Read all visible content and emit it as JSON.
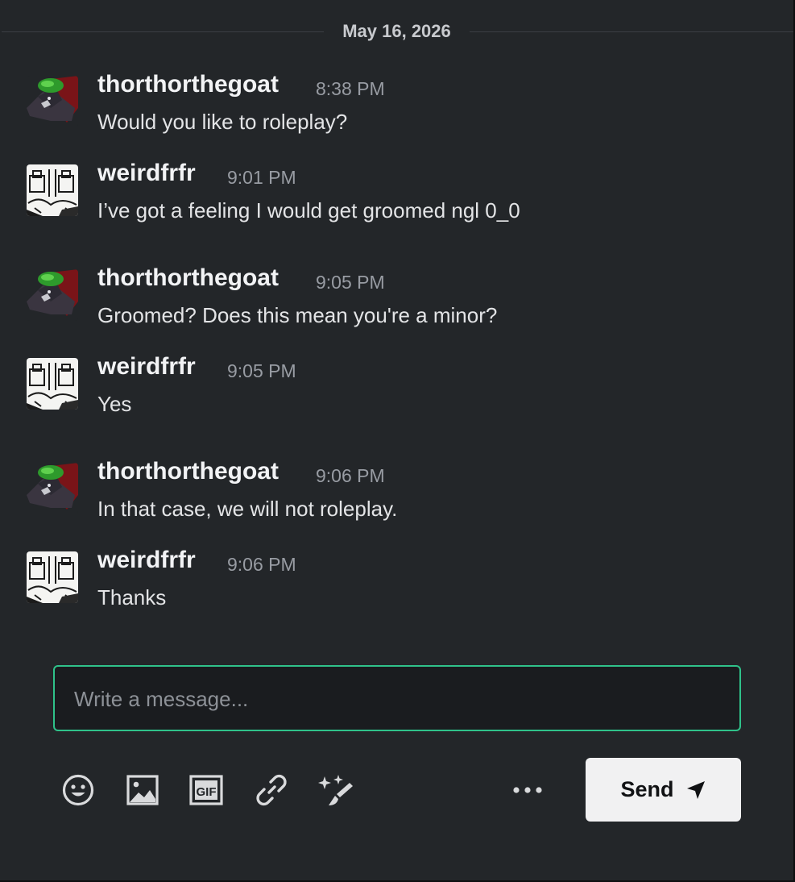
{
  "date_divider": "May 16, 2026",
  "messages": [
    {
      "username": "thorthorthegoat",
      "time": "8:38 PM",
      "text": "Would you like to roleplay?",
      "avatar_icon": "goat-character-avatar-icon"
    },
    {
      "username": "weirdfrfr",
      "time": "9:01 PM",
      "text": "I’ve got a feeling I would get groomed ngl 0_0",
      "avatar_icon": "sketch-drawing-avatar-icon"
    },
    {
      "username": "thorthorthegoat",
      "time": "9:05 PM",
      "text": "Groomed? Does this mean you're a minor?",
      "avatar_icon": "goat-character-avatar-icon"
    },
    {
      "username": "weirdfrfr",
      "time": "9:05 PM",
      "text": "Yes",
      "avatar_icon": "sketch-drawing-avatar-icon"
    },
    {
      "username": "thorthorthegoat",
      "time": "9:06 PM",
      "text": "In that case, we will not roleplay.",
      "avatar_icon": "goat-character-avatar-icon"
    },
    {
      "username": "weirdfrfr",
      "time": "9:06 PM",
      "text": "Thanks",
      "avatar_icon": "sketch-drawing-avatar-icon"
    }
  ],
  "composer": {
    "placeholder": "Write a message...",
    "value": ""
  },
  "toolbar": {
    "icons": [
      "emoji-icon",
      "image-icon",
      "gif-icon",
      "link-icon",
      "sparkle-brush-icon",
      "more-icon"
    ],
    "gif_label": "GIF",
    "send_label": "Send",
    "send_icon": "send-arrow-icon"
  },
  "colors": {
    "background": "#232629",
    "composer_border": "#2fc28a",
    "send_button_bg": "#f1f1f2",
    "timestamp": "#989ca3"
  }
}
